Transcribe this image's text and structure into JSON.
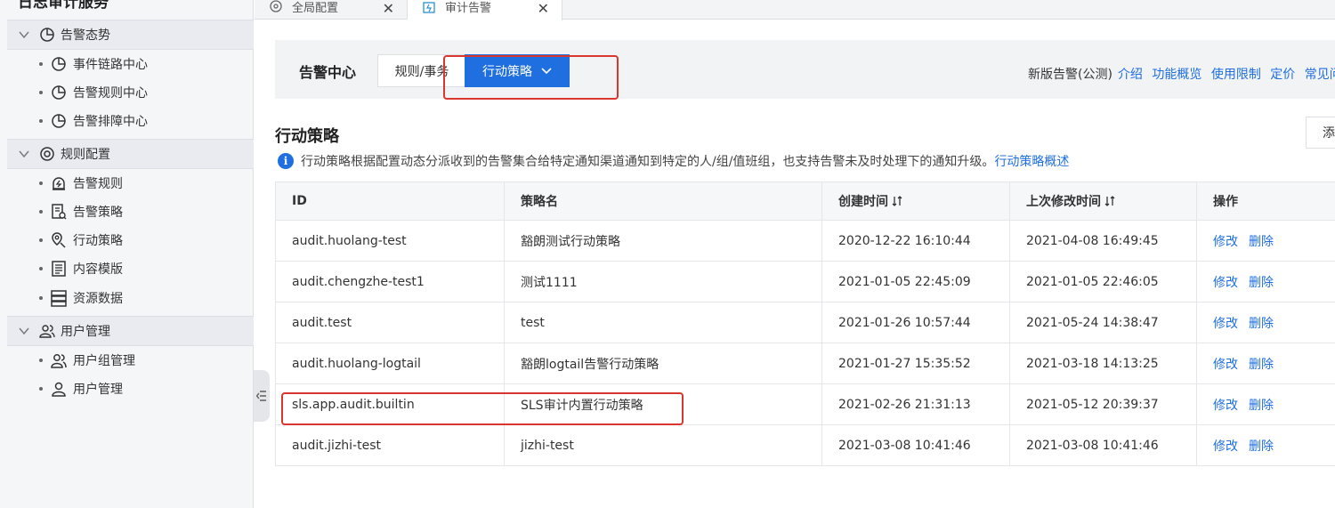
{
  "app": {
    "title": "日志审计服务"
  },
  "tabs": [
    {
      "label": "全局配置"
    },
    {
      "label": "审计告警"
    }
  ],
  "sidebar": {
    "groups": [
      {
        "label": "告警态势",
        "items": [
          "事件链路中心",
          "告警规则中心",
          "告警排障中心"
        ]
      },
      {
        "label": "规则配置",
        "items": [
          "告警规则",
          "告警策略",
          "行动策略",
          "内容模版",
          "资源数据"
        ]
      },
      {
        "label": "用户管理",
        "items": [
          "用户组管理",
          "用户管理"
        ]
      }
    ]
  },
  "center": {
    "title": "告警中心",
    "seg_rules": "规则/事务",
    "seg_action": "行动策略",
    "new_alert": "新版告警(公测)",
    "links": [
      "介绍",
      "功能概览",
      "使用限制",
      "定价",
      "常见问题"
    ]
  },
  "section": {
    "title": "行动策略",
    "add_label": "添",
    "info": "行动策略根据配置动态分派收到的告警集合给特定通知渠道通知到特定的人/组/值班组，也支持告警未及时处理下的通知升级。",
    "info_link": "行动策略概述"
  },
  "table": {
    "headers": [
      "ID",
      "策略名",
      "创建时间",
      "上次修改时间",
      "操作"
    ],
    "rows": [
      [
        "audit.huolang-test",
        "豁朗测试行动策略",
        "2020-12-22 16:10:44",
        "2021-04-08 16:49:45"
      ],
      [
        "audit.chengzhe-test1",
        "测试1111",
        "2021-01-05 22:45:09",
        "2021-01-05 22:46:05"
      ],
      [
        "audit.test",
        "test",
        "2021-01-26 10:57:44",
        "2021-05-24 14:38:47"
      ],
      [
        "audit.huolang-logtail",
        "豁朗logtail告警行动策略",
        "2021-01-27 15:35:52",
        "2021-03-18 14:13:25"
      ],
      [
        "sls.app.audit.builtin",
        "SLS审计内置行动策略",
        "2021-02-26 21:31:13",
        "2021-05-12 20:39:37"
      ],
      [
        "audit.jizhi-test",
        "jizhi-test",
        "2021-03-08 10:41:46",
        "2021-03-08 10:41:46"
      ]
    ],
    "op_edit": "修改",
    "op_delete": "删除"
  },
  "colors": {
    "accent": "#1f6fe0",
    "highlight": "#d9362f"
  }
}
